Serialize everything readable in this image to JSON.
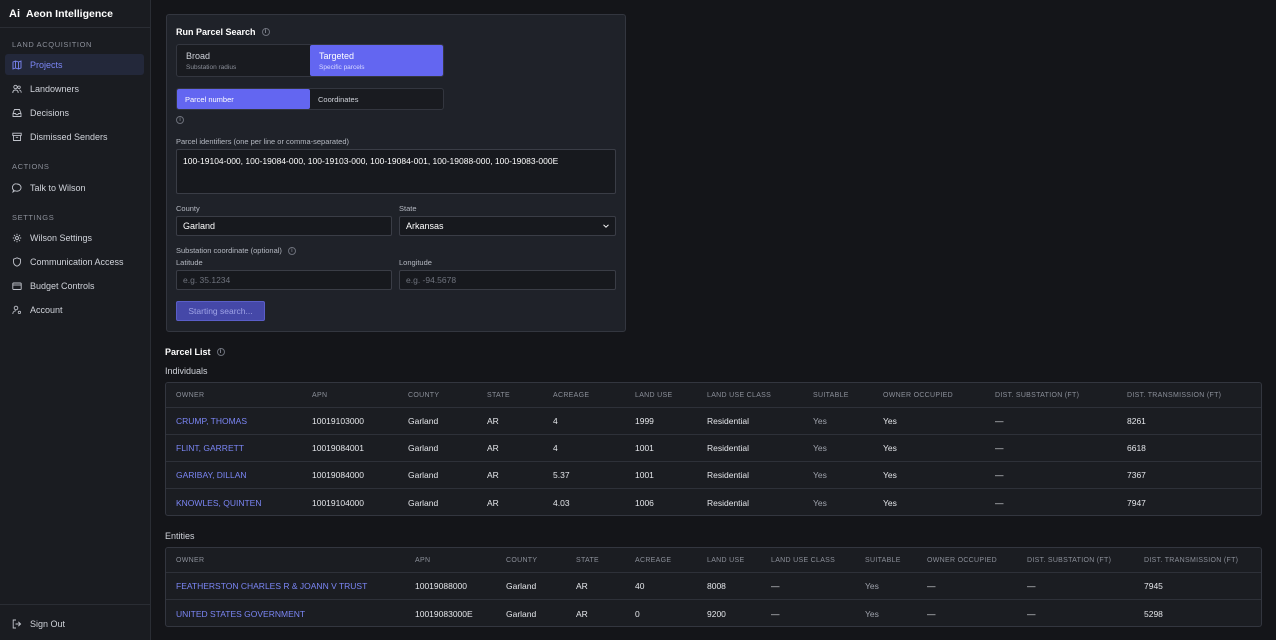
{
  "app": {
    "logo": "Ai",
    "name": "Aeon Intelligence"
  },
  "sidebar": {
    "sections": [
      {
        "label": "LAND ACQUISITION"
      },
      {
        "label": "ACTIONS"
      },
      {
        "label": "SETTINGS"
      }
    ],
    "items": [
      {
        "label": "Projects",
        "icon": "map-icon"
      },
      {
        "label": "Landowners",
        "icon": "users-icon"
      },
      {
        "label": "Decisions",
        "icon": "inbox-icon"
      },
      {
        "label": "Dismissed Senders",
        "icon": "archive-icon"
      },
      {
        "label": "Talk to Wilson",
        "icon": "chat-icon"
      },
      {
        "label": "Wilson Settings",
        "icon": "gear-icon"
      },
      {
        "label": "Communication Access",
        "icon": "shield-icon"
      },
      {
        "label": "Budget Controls",
        "icon": "wallet-icon"
      },
      {
        "label": "Account",
        "icon": "user-gear-icon"
      }
    ],
    "sign_out": "Sign Out"
  },
  "search": {
    "title": "Run Parcel Search",
    "modes": [
      {
        "title": "Broad",
        "subtitle": "Substation radius"
      },
      {
        "title": "Targeted",
        "subtitle": "Specific parcels"
      }
    ],
    "id_modes": [
      "Parcel number",
      "Coordinates"
    ],
    "identifiers_label": "Parcel identifiers (one per line or comma-separated)",
    "identifiers_value": "100-19104-000, 100-19084-000, 100-19103-000, 100-19084-001, 100-19088-000, 100-19083-000E",
    "county_label": "County",
    "county_value": "Garland",
    "state_label": "State",
    "state_value": "Arkansas",
    "substation_label": "Substation coordinate (optional)",
    "latitude_label": "Latitude",
    "latitude_placeholder": "e.g. 35.1234",
    "longitude_label": "Longitude",
    "longitude_placeholder": "e.g. -94.5678",
    "start_button": "Starting search..."
  },
  "parcel_list": {
    "title": "Parcel List",
    "individuals": {
      "label": "Individuals",
      "headers": [
        "OWNER",
        "APN",
        "COUNTY",
        "STATE",
        "ACREAGE",
        "LAND USE",
        "LAND USE CLASS",
        "SUITABLE",
        "OWNER OCCUPIED",
        "DIST. SUBSTATION (FT)",
        "DIST. TRANSMISSION (FT)"
      ],
      "rows": [
        [
          "CRUMP, THOMAS",
          "10019103000",
          "Garland",
          "AR",
          "4",
          "1999",
          "Residential",
          "Yes",
          "Yes",
          "—",
          "8261"
        ],
        [
          "FLINT, GARRETT",
          "10019084001",
          "Garland",
          "AR",
          "4",
          "1001",
          "Residential",
          "Yes",
          "Yes",
          "—",
          "6618"
        ],
        [
          "GARIBAY, DILLAN",
          "10019084000",
          "Garland",
          "AR",
          "5.37",
          "1001",
          "Residential",
          "Yes",
          "Yes",
          "—",
          "7367"
        ],
        [
          "KNOWLES, QUINTEN",
          "10019104000",
          "Garland",
          "AR",
          "4.03",
          "1006",
          "Residential",
          "Yes",
          "Yes",
          "—",
          "7947"
        ]
      ]
    },
    "entities": {
      "label": "Entities",
      "headers": [
        "OWNER",
        "APN",
        "COUNTY",
        "STATE",
        "ACREAGE",
        "LAND USE",
        "LAND USE CLASS",
        "SUITABLE",
        "OWNER OCCUPIED",
        "DIST. SUBSTATION (FT)",
        "DIST. TRANSMISSION (FT)"
      ],
      "rows": [
        [
          "FEATHERSTON CHARLES R & JOANN V TRUST",
          "10019088000",
          "Garland",
          "AR",
          "40",
          "8008",
          "—",
          "Yes",
          "—",
          "—",
          "7945"
        ],
        [
          "UNITED STATES GOVERNMENT",
          "10019083000E",
          "Garland",
          "AR",
          "0",
          "9200",
          "—",
          "Yes",
          "—",
          "—",
          "5298"
        ]
      ]
    }
  }
}
